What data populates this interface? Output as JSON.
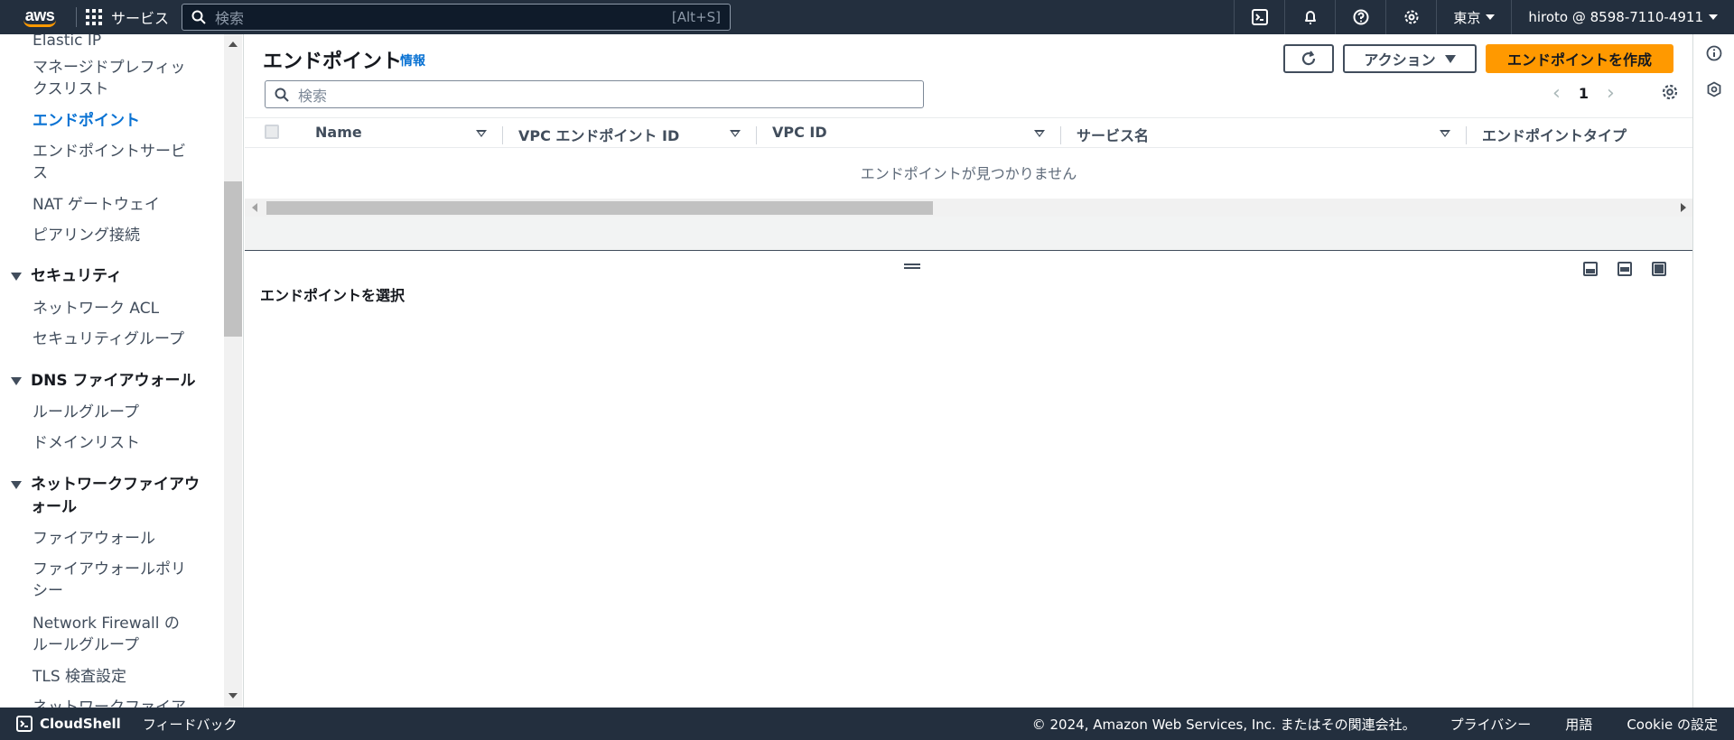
{
  "topnav": {
    "logo": "aws",
    "services_label": "サービス",
    "search_placeholder": "検索",
    "search_shortcut": "[Alt+S]",
    "region": "東京",
    "account": "hiroto @ 8598-7110-4911"
  },
  "sidebar": {
    "items": [
      {
        "label": "Elastic IP",
        "type": "item"
      },
      {
        "label": "マネージドプレフィックスリスト",
        "type": "item"
      },
      {
        "label": "エンドポイント",
        "type": "item",
        "active": true
      },
      {
        "label": "エンドポイントサービス",
        "type": "item"
      },
      {
        "label": "NAT ゲートウェイ",
        "type": "item"
      },
      {
        "label": "ピアリング接続",
        "type": "item"
      },
      {
        "label": "セキュリティ",
        "type": "section"
      },
      {
        "label": "ネットワーク ACL",
        "type": "item"
      },
      {
        "label": "セキュリティグループ",
        "type": "item"
      },
      {
        "label": "DNS ファイアウォール",
        "type": "section"
      },
      {
        "label": "ルールグループ",
        "type": "item"
      },
      {
        "label": "ドメインリスト",
        "type": "item"
      },
      {
        "label": "ネットワークファイアウォール",
        "type": "section"
      },
      {
        "label": "ファイアウォール",
        "type": "item"
      },
      {
        "label": "ファイアウォールポリシー",
        "type": "item"
      },
      {
        "label": "Network Firewall のルールグループ",
        "type": "item"
      },
      {
        "label": "TLS 検査設定",
        "type": "item"
      },
      {
        "label": "ネットワークファイア",
        "type": "item"
      }
    ]
  },
  "main": {
    "title": "エンドポイント",
    "info": "情報",
    "actions_label": "アクション",
    "create_label": "エンドポイントを作成",
    "filter_placeholder": "検索",
    "page_number": "1",
    "columns": [
      "Name",
      "VPC エンドポイント ID",
      "VPC ID",
      "サービス名",
      "エンドポイントタイプ"
    ],
    "empty_message": "エンドポイントが見つかりません",
    "detail_title": "エンドポイントを選択"
  },
  "footer": {
    "cloudshell": "CloudShell",
    "feedback": "フィードバック",
    "copyright": "© 2024, Amazon Web Services, Inc. またはその関連会社。",
    "privacy": "プライバシー",
    "terms": "用語",
    "cookie": "Cookie の設定"
  },
  "colors": {
    "nav_bg": "#232f3e",
    "primary": "#ff9900",
    "link": "#0972d3"
  }
}
